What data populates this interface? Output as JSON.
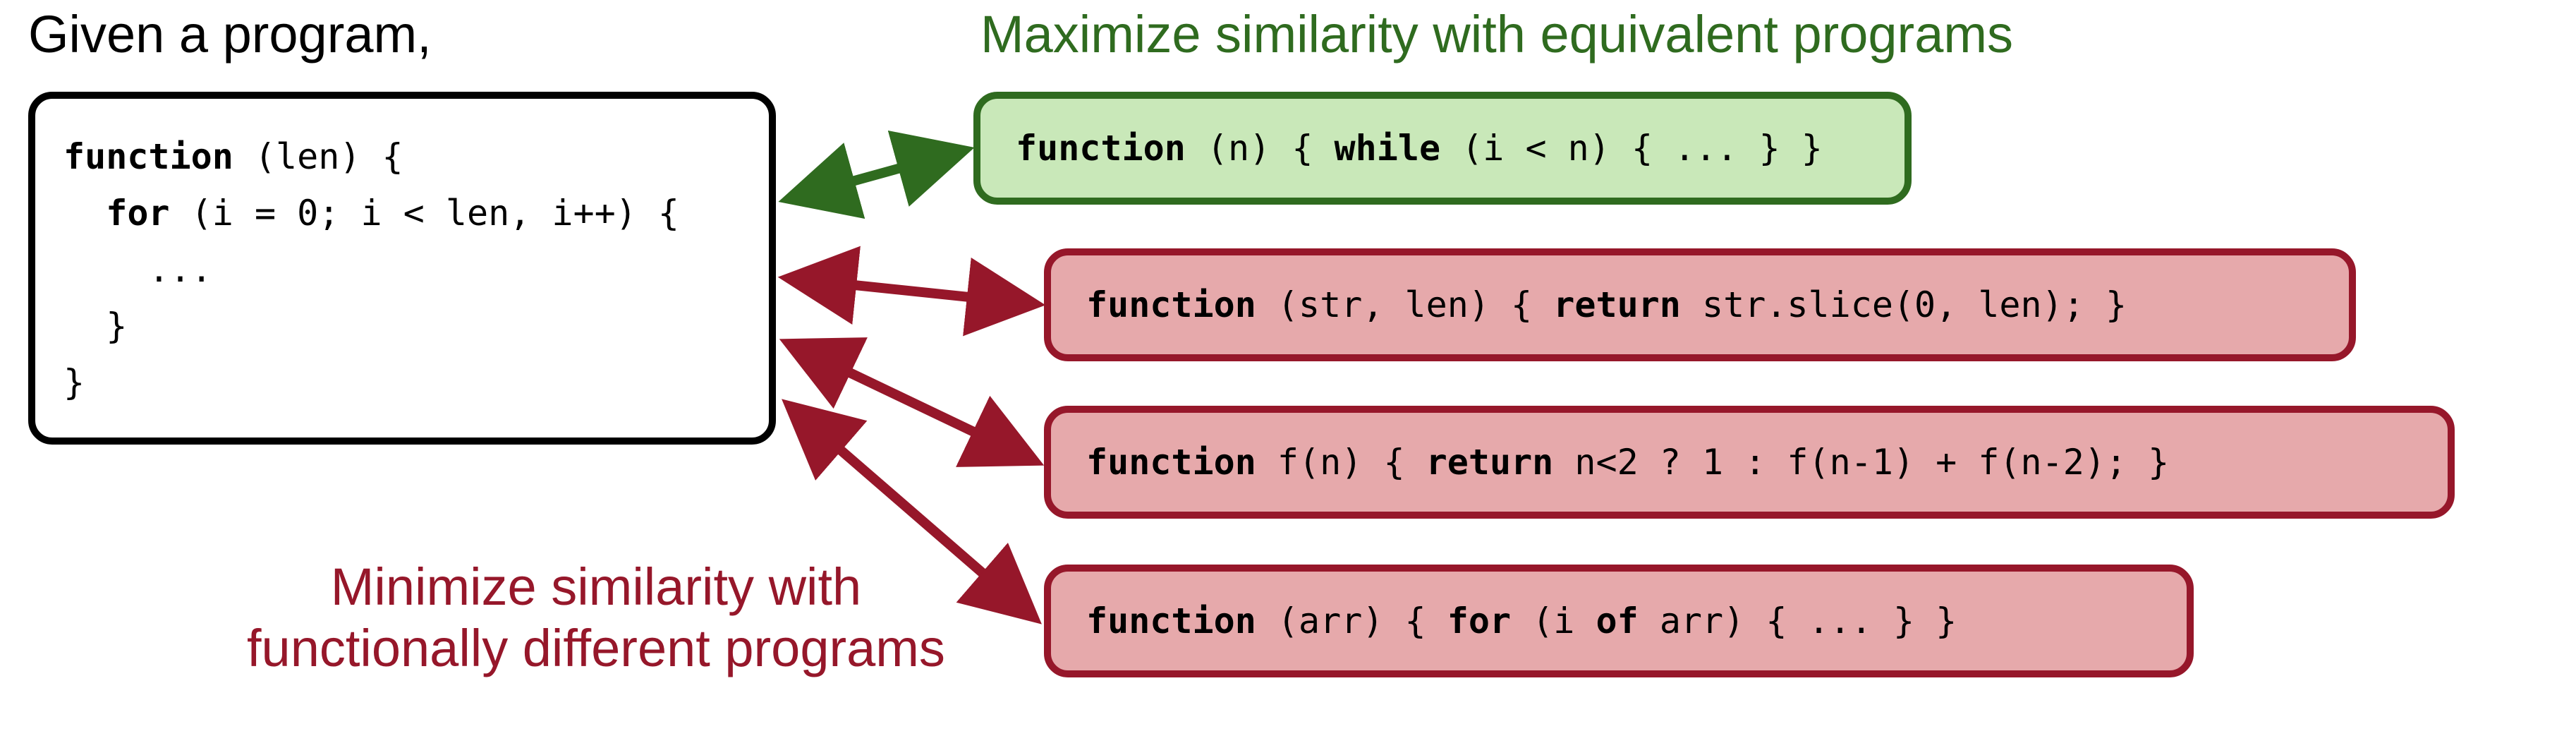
{
  "labels": {
    "given": "Given a program,",
    "maximize": "Maximize similarity with equivalent programs",
    "minimize_l1": "Minimize similarity with",
    "minimize_l2": "functionally different programs"
  },
  "main": {
    "kw_function": "function",
    "sig_paren": " (len) {",
    "kw_for": "for",
    "for_rest": " (i = 0; i < len, i++) {",
    "ellipsis": "...",
    "close_inner": "}",
    "close_outer": "}"
  },
  "green": {
    "kw_function": "function",
    "t1": " (n) { ",
    "kw_while": "while",
    "t2": " (i < n) { ... } }"
  },
  "r1": {
    "kw_function": "function",
    "t1": " (str, len) { ",
    "kw_return": "return",
    "t2": " str.slice(0, len); }"
  },
  "r2": {
    "kw_function": "function",
    "t1": " f(n) { ",
    "kw_return": "return",
    "t2": " n<2 ? 1 : f(n-1) + f(n-2); }"
  },
  "r3": {
    "kw_function": "function",
    "t1": " (arr) { ",
    "kw_for": "for",
    "t2": " (i ",
    "kw_of": "of",
    "t3": " arr) { ... } }"
  },
  "colors": {
    "green_stroke": "#2f6b1f",
    "green_fill": "#c9e8b9",
    "red_stroke": "#96172a",
    "red_fill": "#e6a9ab"
  }
}
